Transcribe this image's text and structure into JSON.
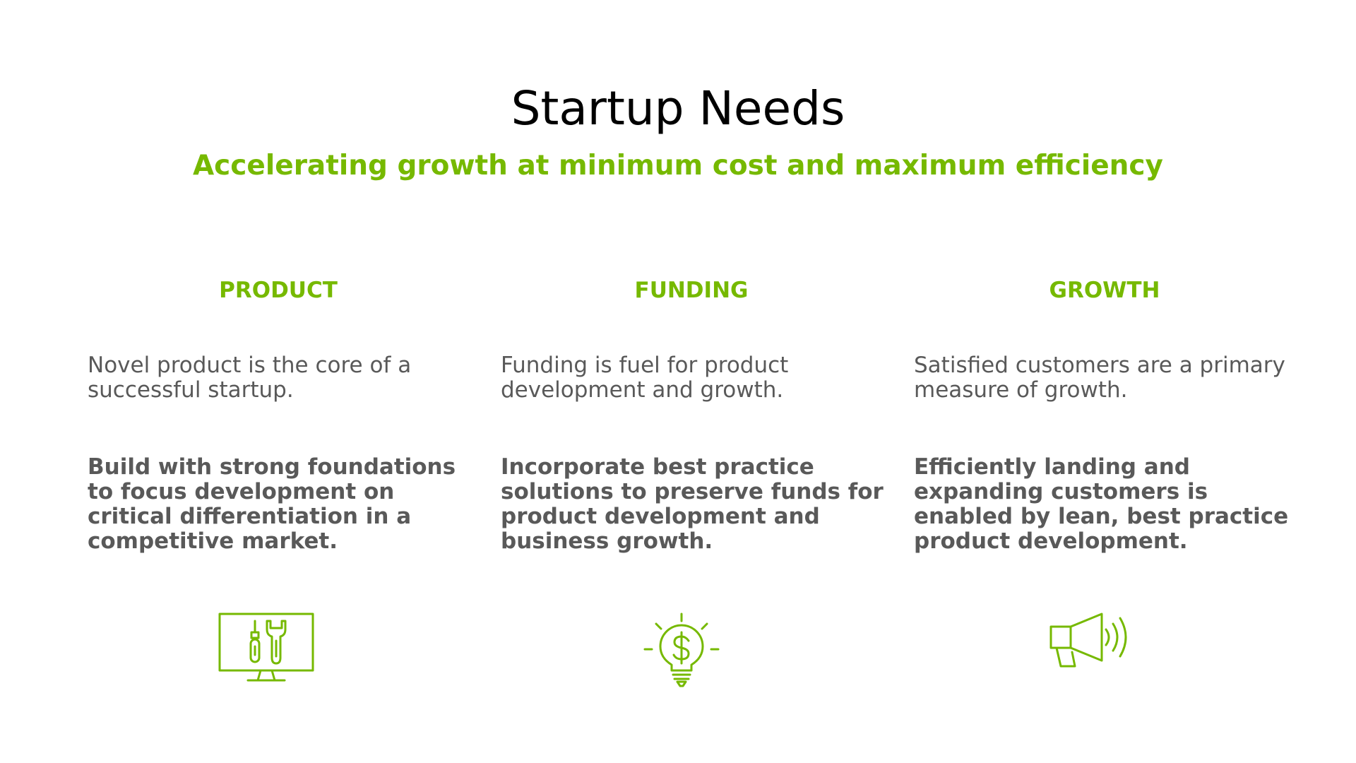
{
  "slide": {
    "title": "Startup Needs",
    "subtitle": "Accelerating growth at minimum cost and maximum efficiency",
    "accent_color": "#76b900",
    "text_color": "#595959"
  },
  "columns": [
    {
      "heading": "PRODUCT",
      "intro": "Novel product is the core of a successful startup.",
      "detail": "Build with strong foundations to focus development on critical differentiation in a competitive market.",
      "icon": "monitor-tools-icon"
    },
    {
      "heading": "FUNDING",
      "intro": "Funding is fuel for product development and growth.",
      "detail": "Incorporate best practice solutions to preserve funds for product development and business growth.",
      "icon": "lightbulb-dollar-icon"
    },
    {
      "heading": "GROWTH",
      "intro": "Satisfied customers are a primary measure of growth.",
      "detail": "Efficiently landing and expanding customers is enabled by lean, best practice product development.",
      "icon": "megaphone-icon"
    }
  ]
}
